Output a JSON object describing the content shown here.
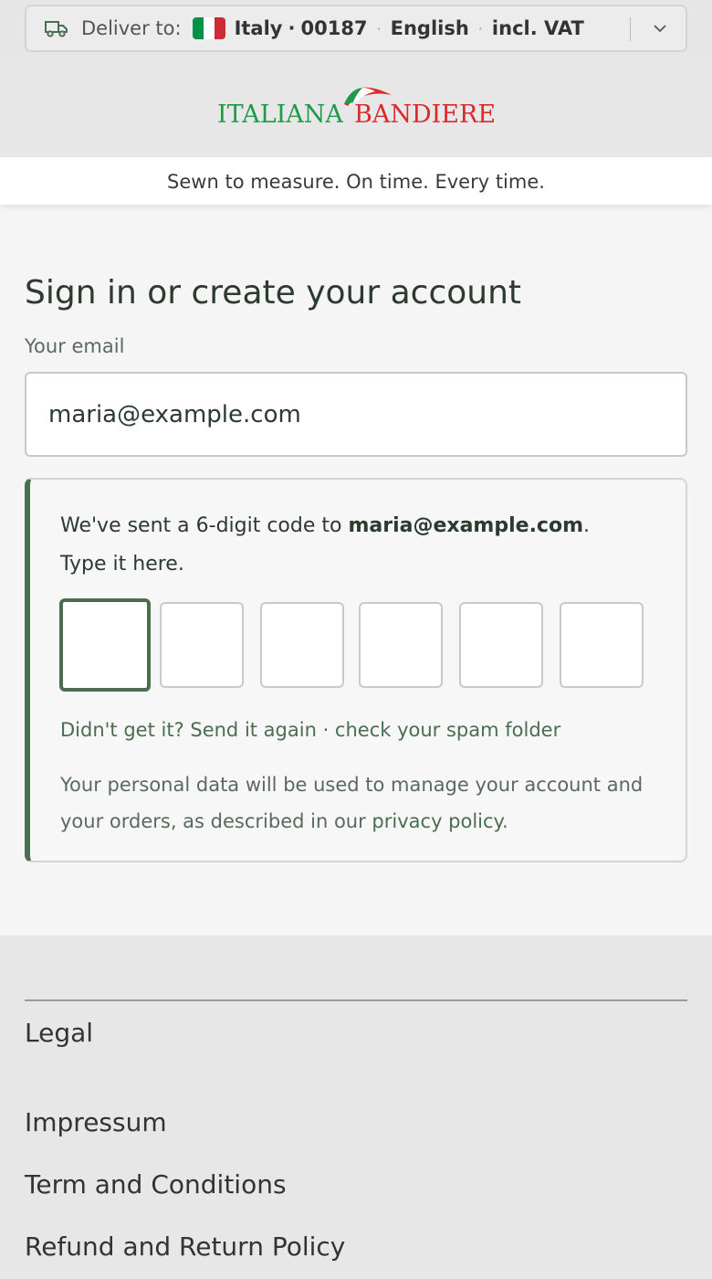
{
  "delivery": {
    "label": "Deliver to:",
    "country": "Italy",
    "postal_code": "00187",
    "language": "English",
    "tax": "incl. VAT",
    "flag_colors": [
      "#009246",
      "#ffffff",
      "#ce2b37"
    ]
  },
  "brand": {
    "name_left": "ITALIANA",
    "name_right": "BANDIERE",
    "green": "#1f9a4a",
    "red": "#d92b2b"
  },
  "tagline": "Sewn to measure. On time. Every time.",
  "signin": {
    "title": "Sign in or create your account",
    "email_label": "Your email",
    "email_value": "maria@example.com",
    "code_msg_prefix": "We've sent a 6-digit code to ",
    "code_msg_email": "maria@example.com",
    "code_msg_suffix": ".",
    "code_msg_line2": "Type it here.",
    "digits": [
      "",
      "",
      "",
      "",
      "",
      ""
    ],
    "resend_text": "Didn't get it? Send it again · check your spam folder",
    "privacy_prefix": "Your personal data will be used to manage your account and your orders, as described in our ",
    "privacy_link": "privacy policy",
    "privacy_suffix": "."
  },
  "footer": {
    "heading": "Legal",
    "links": [
      "Impressum",
      "Term and Conditions",
      "Refund and Return Policy"
    ]
  },
  "colors": {
    "accent": "#4b6e50"
  }
}
